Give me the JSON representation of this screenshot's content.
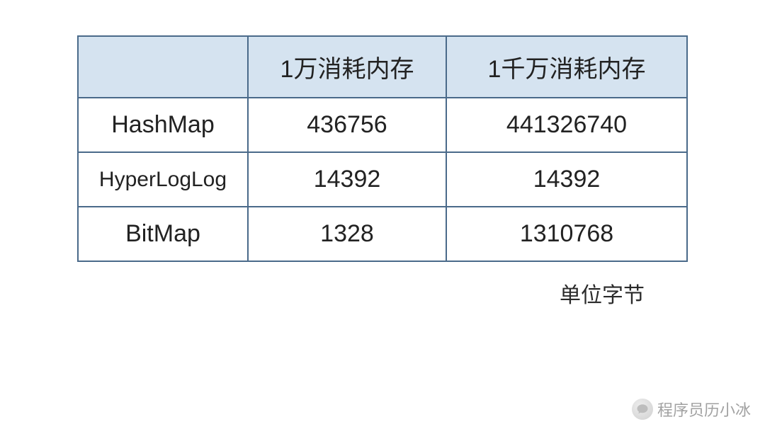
{
  "chart_data": {
    "type": "table",
    "title": "",
    "columns": [
      "",
      "1万消耗内存",
      "1千万消耗内存"
    ],
    "rows": [
      {
        "name": "HashMap",
        "values": [
          436756,
          441326740
        ]
      },
      {
        "name": "HyperLogLog",
        "values": [
          14392,
          14392
        ]
      },
      {
        "name": "BitMap",
        "values": [
          1328,
          1310768
        ]
      }
    ],
    "unit_label": "单位字节"
  },
  "headers": {
    "blank": "",
    "col1": "1万消耗内存",
    "col2": "1千万消耗内存"
  },
  "rows": {
    "r0": {
      "name": "HashMap",
      "v1": "436756",
      "v2": "441326740"
    },
    "r1": {
      "name": "HyperLogLog",
      "v1": "14392",
      "v2": "14392"
    },
    "r2": {
      "name": "BitMap",
      "v1": "1328",
      "v2": "1310768"
    }
  },
  "caption": "单位字节",
  "watermark": {
    "text": "程序员历小冰"
  }
}
